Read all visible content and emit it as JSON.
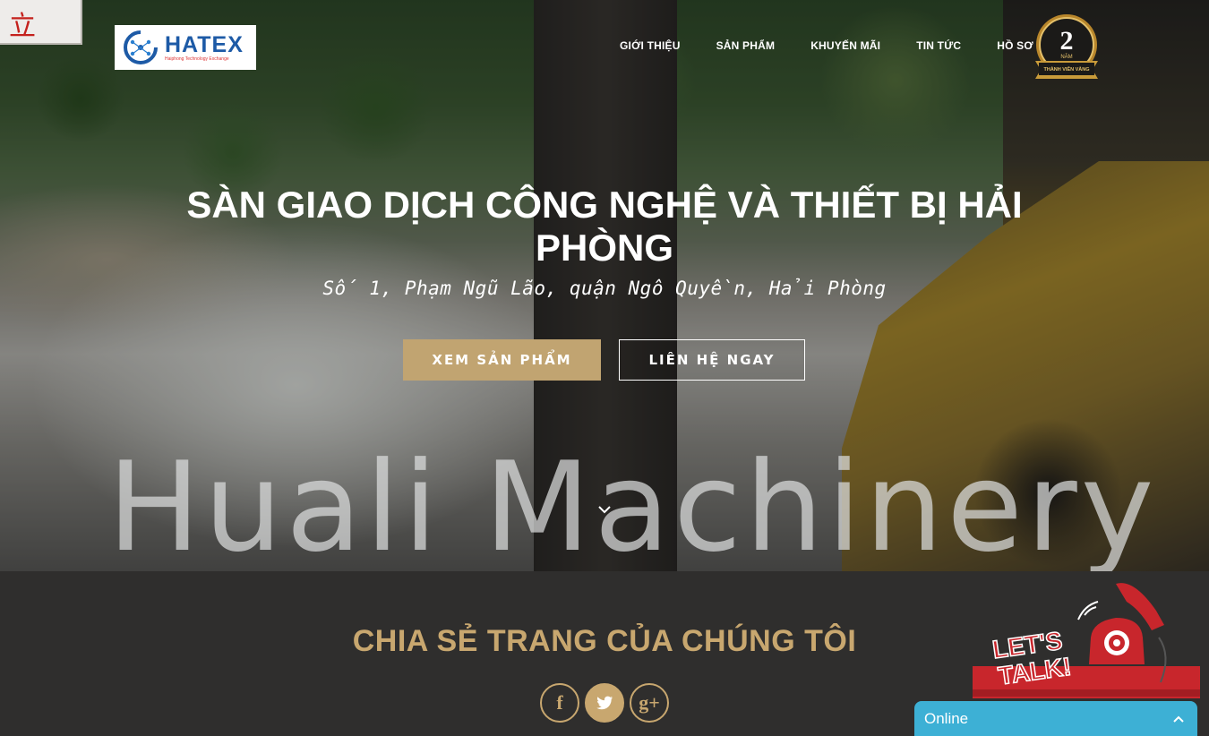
{
  "corner_sign": {
    "text": "立"
  },
  "logo": {
    "name": "HATEX",
    "tagline": "Haiphong Technology Exchange"
  },
  "nav": {
    "items": [
      {
        "label": "GIỚI THIỆU"
      },
      {
        "label": "SẢN PHẨM"
      },
      {
        "label": "KHUYẾN MÃI"
      },
      {
        "label": "TIN TỨC"
      },
      {
        "label": "HỒ SƠ"
      }
    ]
  },
  "badge": {
    "number": "2",
    "years": "NĂM",
    "caption": "THÀNH VIÊN VÀNG"
  },
  "hero": {
    "title": "SÀN GIAO DỊCH CÔNG NGHỆ VÀ THIẾT BỊ HẢI PHÒNG",
    "subtitle": "Số 1, Phạm Ngũ Lão, quận Ngô Quyền, Hải Phòng",
    "primary_button": "XEM SẢN PHẨM",
    "secondary_button": "LIÊN HỆ NGAY",
    "watermark": "Huali Machinery"
  },
  "share": {
    "heading": "CHIA SẺ TRANG CỦA CHÚNG TÔI",
    "facebook": "f",
    "google_plus": "g+"
  },
  "lets_talk": {
    "line1": "LET'S",
    "line2": "TALK!"
  },
  "chat": {
    "status": "Online"
  },
  "colors": {
    "accent": "#c1a471",
    "chat": "#3db0d5",
    "footer_bg": "#2f2e2d"
  }
}
